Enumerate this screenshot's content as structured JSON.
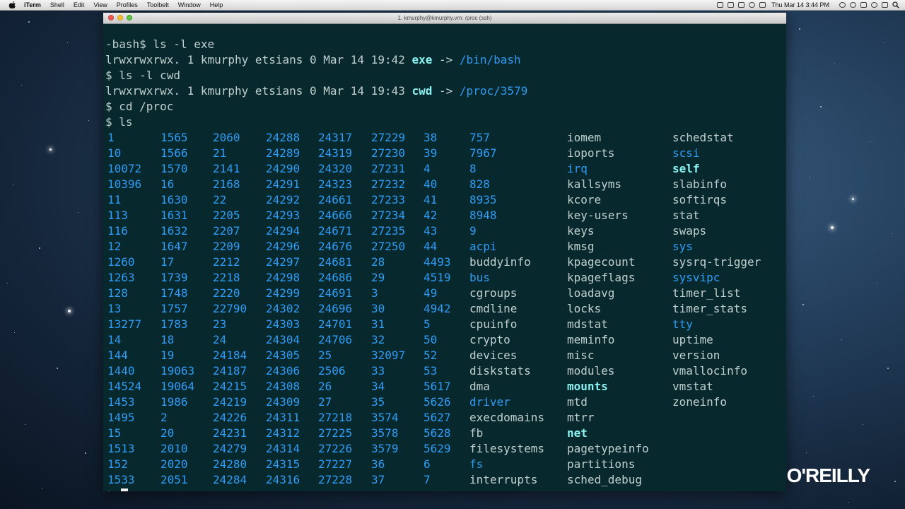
{
  "menubar": {
    "app_name": "iTerm",
    "menus": [
      "Shell",
      "Edit",
      "View",
      "Profiles",
      "Toolbelt",
      "Window",
      "Help"
    ],
    "clock": "Thu Mar 14  3:44 PM"
  },
  "window": {
    "title": "1. kmurphy@kmurphy.vm: /proc (ssh)"
  },
  "terminal": {
    "header_lines": [
      {
        "type": "plain",
        "text": "-bash$ ls -l exe"
      },
      {
        "type": "symlink",
        "prefix": "lrwxrwxrwx. 1 kmurphy etsians 0 Mar 14 19:42 ",
        "name": "exe",
        "arrow": " -> ",
        "target": "/bin/bash"
      },
      {
        "type": "plain",
        "text": "$ ls -l cwd"
      },
      {
        "type": "symlink",
        "prefix": "lrwxrwxrwx. 1 kmurphy etsians 0 Mar 14 19:43 ",
        "name": "cwd",
        "arrow": " -> ",
        "target": "/proc/3579"
      },
      {
        "type": "plain",
        "text": "$ cd /proc"
      },
      {
        "type": "plain",
        "text": "$ ls"
      }
    ],
    "ls_columns": [
      [
        [
          "1",
          "num"
        ],
        [
          "10",
          "num"
        ],
        [
          "10072",
          "num"
        ],
        [
          "10396",
          "num"
        ],
        [
          "11",
          "num"
        ],
        [
          "113",
          "num"
        ],
        [
          "116",
          "num"
        ],
        [
          "12",
          "num"
        ],
        [
          "1260",
          "num"
        ],
        [
          "1263",
          "num"
        ],
        [
          "128",
          "num"
        ],
        [
          "13",
          "num"
        ],
        [
          "13277",
          "num"
        ],
        [
          "14",
          "num"
        ],
        [
          "144",
          "num"
        ],
        [
          "1440",
          "num"
        ],
        [
          "14524",
          "num"
        ],
        [
          "1453",
          "num"
        ],
        [
          "1495",
          "num"
        ],
        [
          "15",
          "num"
        ],
        [
          "1513",
          "num"
        ],
        [
          "152",
          "num"
        ],
        [
          "1533",
          "num"
        ]
      ],
      [
        [
          "1565",
          "num"
        ],
        [
          "1566",
          "num"
        ],
        [
          "1570",
          "num"
        ],
        [
          "16",
          "num"
        ],
        [
          "1630",
          "num"
        ],
        [
          "1631",
          "num"
        ],
        [
          "1632",
          "num"
        ],
        [
          "1647",
          "num"
        ],
        [
          "17",
          "num"
        ],
        [
          "1739",
          "num"
        ],
        [
          "1748",
          "num"
        ],
        [
          "1757",
          "num"
        ],
        [
          "1783",
          "num"
        ],
        [
          "18",
          "num"
        ],
        [
          "19",
          "num"
        ],
        [
          "19063",
          "num"
        ],
        [
          "19064",
          "num"
        ],
        [
          "1986",
          "num"
        ],
        [
          "2",
          "num"
        ],
        [
          "20",
          "num"
        ],
        [
          "2010",
          "num"
        ],
        [
          "2020",
          "num"
        ],
        [
          "2051",
          "num"
        ]
      ],
      [
        [
          "2060",
          "num"
        ],
        [
          "21",
          "num"
        ],
        [
          "2141",
          "num"
        ],
        [
          "2168",
          "num"
        ],
        [
          "22",
          "num"
        ],
        [
          "2205",
          "num"
        ],
        [
          "2207",
          "num"
        ],
        [
          "2209",
          "num"
        ],
        [
          "2212",
          "num"
        ],
        [
          "2218",
          "num"
        ],
        [
          "2220",
          "num"
        ],
        [
          "22790",
          "num"
        ],
        [
          "23",
          "num"
        ],
        [
          "24",
          "num"
        ],
        [
          "24184",
          "num"
        ],
        [
          "24187",
          "num"
        ],
        [
          "24215",
          "num"
        ],
        [
          "24219",
          "num"
        ],
        [
          "24226",
          "num"
        ],
        [
          "24231",
          "num"
        ],
        [
          "24279",
          "num"
        ],
        [
          "24280",
          "num"
        ],
        [
          "24284",
          "num"
        ]
      ],
      [
        [
          "24288",
          "num"
        ],
        [
          "24289",
          "num"
        ],
        [
          "24290",
          "num"
        ],
        [
          "24291",
          "num"
        ],
        [
          "24292",
          "num"
        ],
        [
          "24293",
          "num"
        ],
        [
          "24294",
          "num"
        ],
        [
          "24296",
          "num"
        ],
        [
          "24297",
          "num"
        ],
        [
          "24298",
          "num"
        ],
        [
          "24299",
          "num"
        ],
        [
          "24302",
          "num"
        ],
        [
          "24303",
          "num"
        ],
        [
          "24304",
          "num"
        ],
        [
          "24305",
          "num"
        ],
        [
          "24306",
          "num"
        ],
        [
          "24308",
          "num"
        ],
        [
          "24309",
          "num"
        ],
        [
          "24311",
          "num"
        ],
        [
          "24312",
          "num"
        ],
        [
          "24314",
          "num"
        ],
        [
          "24315",
          "num"
        ],
        [
          "24316",
          "num"
        ]
      ],
      [
        [
          "24317",
          "num"
        ],
        [
          "24319",
          "num"
        ],
        [
          "24320",
          "num"
        ],
        [
          "24323",
          "num"
        ],
        [
          "24661",
          "num"
        ],
        [
          "24666",
          "num"
        ],
        [
          "24671",
          "num"
        ],
        [
          "24676",
          "num"
        ],
        [
          "24681",
          "num"
        ],
        [
          "24686",
          "num"
        ],
        [
          "24691",
          "num"
        ],
        [
          "24696",
          "num"
        ],
        [
          "24701",
          "num"
        ],
        [
          "24706",
          "num"
        ],
        [
          "25",
          "num"
        ],
        [
          "2506",
          "num"
        ],
        [
          "26",
          "num"
        ],
        [
          "27",
          "num"
        ],
        [
          "27218",
          "num"
        ],
        [
          "27225",
          "num"
        ],
        [
          "27226",
          "num"
        ],
        [
          "27227",
          "num"
        ],
        [
          "27228",
          "num"
        ]
      ],
      [
        [
          "27229",
          "num"
        ],
        [
          "27230",
          "num"
        ],
        [
          "27231",
          "num"
        ],
        [
          "27232",
          "num"
        ],
        [
          "27233",
          "num"
        ],
        [
          "27234",
          "num"
        ],
        [
          "27235",
          "num"
        ],
        [
          "27250",
          "num"
        ],
        [
          "28",
          "num"
        ],
        [
          "29",
          "num"
        ],
        [
          "3",
          "num"
        ],
        [
          "30",
          "num"
        ],
        [
          "31",
          "num"
        ],
        [
          "32",
          "num"
        ],
        [
          "32097",
          "num"
        ],
        [
          "33",
          "num"
        ],
        [
          "34",
          "num"
        ],
        [
          "35",
          "num"
        ],
        [
          "3574",
          "num"
        ],
        [
          "3578",
          "num"
        ],
        [
          "3579",
          "num"
        ],
        [
          "36",
          "num"
        ],
        [
          "37",
          "num"
        ]
      ],
      [
        [
          "38",
          "num"
        ],
        [
          "39",
          "num"
        ],
        [
          "4",
          "num"
        ],
        [
          "40",
          "num"
        ],
        [
          "41",
          "num"
        ],
        [
          "42",
          "num"
        ],
        [
          "43",
          "num"
        ],
        [
          "44",
          "num"
        ],
        [
          "4493",
          "num"
        ],
        [
          "4519",
          "num"
        ],
        [
          "49",
          "num"
        ],
        [
          "4942",
          "num"
        ],
        [
          "5",
          "num"
        ],
        [
          "50",
          "num"
        ],
        [
          "52",
          "num"
        ],
        [
          "53",
          "num"
        ],
        [
          "5617",
          "num"
        ],
        [
          "5626",
          "num"
        ],
        [
          "5627",
          "num"
        ],
        [
          "5628",
          "num"
        ],
        [
          "5629",
          "num"
        ],
        [
          "6",
          "num"
        ],
        [
          "7",
          "num"
        ]
      ],
      [
        [
          "757",
          "num"
        ],
        [
          "7967",
          "num"
        ],
        [
          "8",
          "num"
        ],
        [
          "828",
          "num"
        ],
        [
          "8935",
          "num"
        ],
        [
          "8948",
          "num"
        ],
        [
          "9",
          "num"
        ],
        [
          "acpi",
          "dir"
        ],
        [
          "buddyinfo",
          "file"
        ],
        [
          "bus",
          "dir"
        ],
        [
          "cgroups",
          "file"
        ],
        [
          "cmdline",
          "file"
        ],
        [
          "cpuinfo",
          "file"
        ],
        [
          "crypto",
          "file"
        ],
        [
          "devices",
          "file"
        ],
        [
          "diskstats",
          "file"
        ],
        [
          "dma",
          "file"
        ],
        [
          "driver",
          "dir"
        ],
        [
          "execdomains",
          "file"
        ],
        [
          "fb",
          "file"
        ],
        [
          "filesystems",
          "file"
        ],
        [
          "fs",
          "dir"
        ],
        [
          "interrupts",
          "file"
        ]
      ],
      [
        [
          "iomem",
          "file"
        ],
        [
          "ioports",
          "file"
        ],
        [
          "irq",
          "dir"
        ],
        [
          "kallsyms",
          "file"
        ],
        [
          "kcore",
          "file"
        ],
        [
          "key-users",
          "file"
        ],
        [
          "keys",
          "file"
        ],
        [
          "kmsg",
          "file"
        ],
        [
          "kpagecount",
          "file"
        ],
        [
          "kpageflags",
          "file"
        ],
        [
          "loadavg",
          "file"
        ],
        [
          "locks",
          "file"
        ],
        [
          "mdstat",
          "file"
        ],
        [
          "meminfo",
          "file"
        ],
        [
          "misc",
          "file"
        ],
        [
          "modules",
          "file"
        ],
        [
          "mounts",
          "link"
        ],
        [
          "mtd",
          "file"
        ],
        [
          "mtrr",
          "file"
        ],
        [
          "net",
          "link"
        ],
        [
          "pagetypeinfo",
          "file"
        ],
        [
          "partitions",
          "file"
        ],
        [
          "sched_debug",
          "file"
        ]
      ],
      [
        [
          "schedstat",
          "file"
        ],
        [
          "scsi",
          "dir"
        ],
        [
          "self",
          "link"
        ],
        [
          "slabinfo",
          "file"
        ],
        [
          "softirqs",
          "file"
        ],
        [
          "stat",
          "file"
        ],
        [
          "swaps",
          "file"
        ],
        [
          "sys",
          "dir"
        ],
        [
          "sysrq-trigger",
          "file"
        ],
        [
          "sysvipc",
          "dir"
        ],
        [
          "timer_list",
          "file"
        ],
        [
          "timer_stats",
          "file"
        ],
        [
          "tty",
          "dir"
        ],
        [
          "uptime",
          "file"
        ],
        [
          "version",
          "file"
        ],
        [
          "vmallocinfo",
          "file"
        ],
        [
          "vmstat",
          "file"
        ],
        [
          "zoneinfo",
          "file"
        ]
      ]
    ],
    "prompt": "$"
  },
  "watermark": {
    "text": "O'REILLY"
  },
  "colors": {
    "terminal_bg": "#07292d",
    "plain_text": "#c2cfcf",
    "directory_blue": "#2f9cf5",
    "symlink_cyan": "#8af2f2"
  }
}
